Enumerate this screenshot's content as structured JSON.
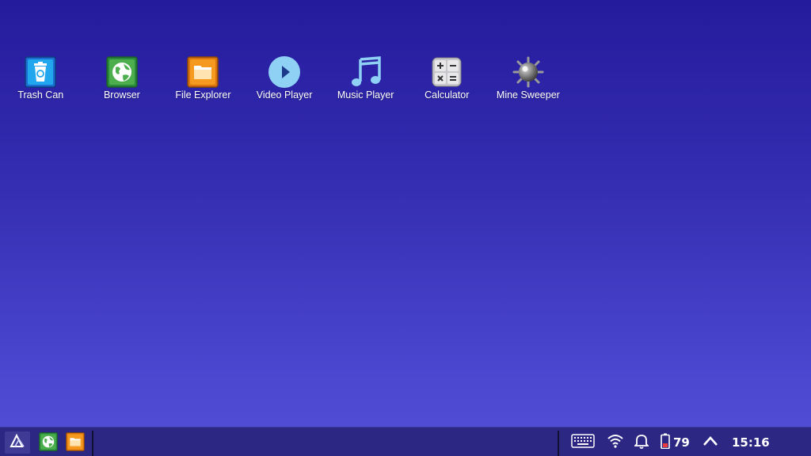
{
  "desktop": {
    "icons": [
      {
        "label": "Trash Can",
        "icon": "trash-can-icon"
      },
      {
        "label": "Browser",
        "icon": "browser-globe-icon"
      },
      {
        "label": "File Explorer",
        "icon": "folder-icon"
      },
      {
        "label": "Video Player",
        "icon": "play-circle-icon"
      },
      {
        "label": "Music Player",
        "icon": "music-note-icon"
      },
      {
        "label": "Calculator",
        "icon": "calculator-icon"
      },
      {
        "label": "Mine Sweeper",
        "icon": "mine-icon"
      }
    ]
  },
  "taskbar": {
    "start_icon": "launcher-logo-icon",
    "pinned": [
      "browser-globe-icon",
      "folder-icon"
    ],
    "tray": {
      "keyboard_icon": "keyboard-icon",
      "wifi_icon": "wifi-icon",
      "notification_icon": "bell-icon",
      "battery_icon": "battery-icon",
      "battery_level": "79",
      "expand_icon": "chevron-up-icon"
    },
    "clock": "15:16"
  },
  "colors": {
    "background_top": "#241a9c",
    "background_bottom": "#544fd6",
    "taskbar": "#2c2782"
  }
}
